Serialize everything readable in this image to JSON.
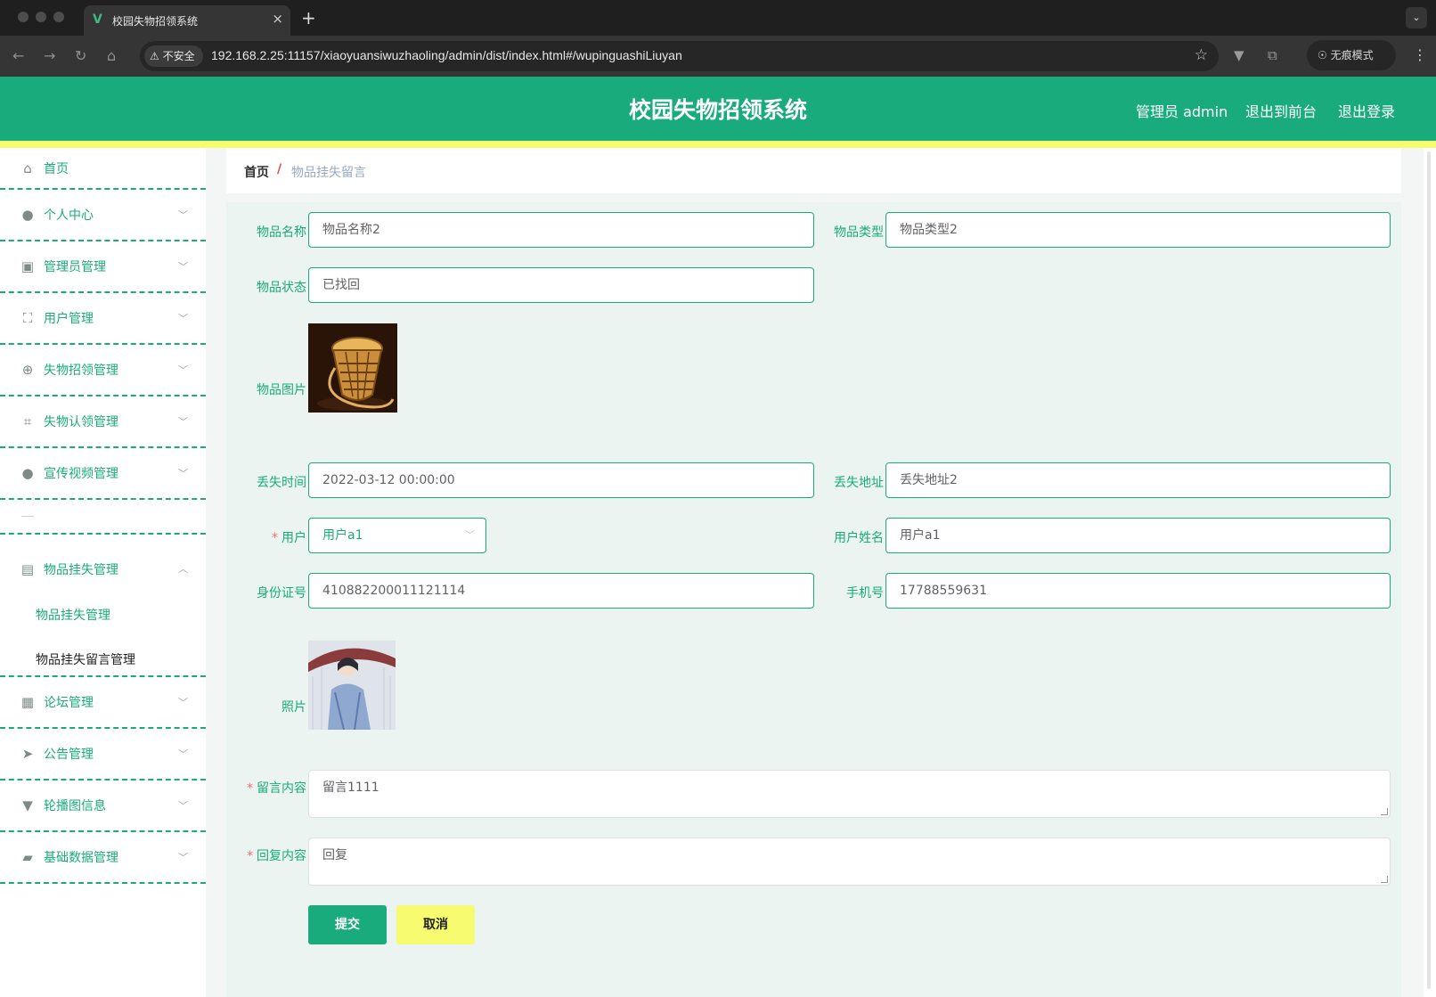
{
  "browser": {
    "tab_title": "校园失物招领系统",
    "tab_logo": "V",
    "new_tab_label": "+",
    "close_label": "×",
    "security_label": "不安全",
    "url": "192.168.2.25:11157/xiaoyuansiwuzhaoling/admin/dist/index.html#/wupinguashiLiuyan",
    "incognito_label": "无痕模式",
    "icons": [
      "back-icon",
      "forward-icon",
      "reload-icon",
      "home-icon",
      "warning-icon",
      "star-icon",
      "extension-icon",
      "puzzle-icon",
      "incognito-icon",
      "kebab-icon"
    ]
  },
  "header": {
    "title": "校园失物招领系统",
    "user_label": "管理员 admin",
    "to_front_label": "退出到前台",
    "logout_label": "退出登录"
  },
  "sidebar": {
    "items": [
      {
        "label": "首页",
        "icon": "home-icon"
      },
      {
        "label": "个人中心",
        "icon": "user-icon"
      },
      {
        "label": "管理员管理",
        "icon": "clipboard-icon"
      },
      {
        "label": "用户管理",
        "icon": "fullscreen-icon"
      },
      {
        "label": "失物招领管理",
        "icon": "crosshair-icon"
      },
      {
        "label": "失物认领管理",
        "icon": "crop-icon"
      },
      {
        "label": "宣传视频管理",
        "icon": "user-icon"
      },
      {
        "label": "物品挂失管理",
        "icon": "briefcase-icon"
      },
      {
        "label": "论坛管理",
        "icon": "grid-icon"
      },
      {
        "label": "公告管理",
        "icon": "send-icon"
      },
      {
        "label": "轮播图信息",
        "icon": "brush-icon"
      },
      {
        "label": "基础数据管理",
        "icon": "ticket-icon"
      }
    ],
    "submenu": [
      "物品挂失管理",
      "物品挂失留言管理"
    ]
  },
  "breadcrumb": {
    "home": "首页",
    "separator": "/",
    "current": "物品挂失留言"
  },
  "form": {
    "item_name": {
      "label": "物品名称",
      "value": "物品名称2"
    },
    "item_type": {
      "label": "物品类型",
      "value": "物品类型2"
    },
    "item_status": {
      "label": "物品状态",
      "value": "已找回"
    },
    "item_image": {
      "label": "物品图片"
    },
    "lost_time": {
      "label": "丢失时间",
      "value": "2022-03-12 00:00:00"
    },
    "lost_address": {
      "label": "丢失地址",
      "value": "丢失地址2"
    },
    "user": {
      "label": "用户",
      "value": "用户a1"
    },
    "user_name": {
      "label": "用户姓名",
      "value": "用户a1"
    },
    "id_number": {
      "label": "身份证号",
      "value": "410882200011121114"
    },
    "phone": {
      "label": "手机号",
      "value": "17788559631"
    },
    "photo": {
      "label": "照片"
    },
    "message": {
      "label": "留言内容",
      "value": "留言1111"
    },
    "reply": {
      "label": "回复内容",
      "value": "回复"
    },
    "required_mark": "*",
    "submit_label": "提交",
    "cancel_label": "取消"
  },
  "colors": {
    "primary": "#1aab7c",
    "accent_yellow": "#f6fb6f",
    "danger": "#f56c6c"
  }
}
